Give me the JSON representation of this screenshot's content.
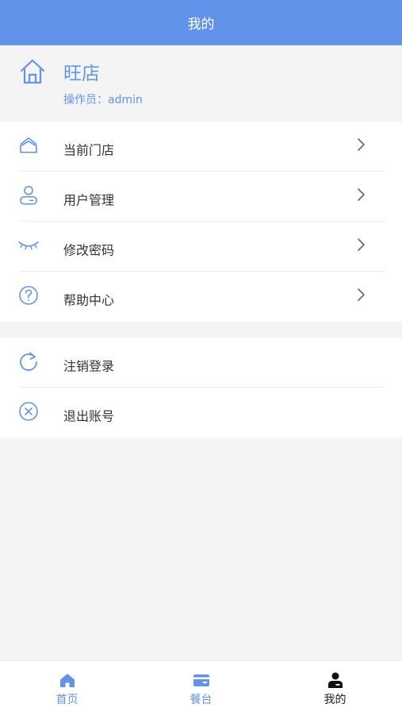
{
  "header": {
    "title": "我的"
  },
  "profile": {
    "store_name": "旺店",
    "operator": "操作员：admin",
    "icon": "home-outline-icon"
  },
  "menu_group_1": [
    {
      "label": "当前门店",
      "icon": "store-icon"
    },
    {
      "label": "用户管理",
      "icon": "user-icon"
    },
    {
      "label": "修改密码",
      "icon": "eye-closed-icon"
    },
    {
      "label": "帮助中心",
      "icon": "help-circle-icon"
    }
  ],
  "menu_group_2": [
    {
      "label": "注销登录",
      "icon": "refresh-icon"
    },
    {
      "label": "退出账号",
      "icon": "close-circle-icon"
    }
  ],
  "tab_bar": {
    "tabs": [
      {
        "label": "首页",
        "icon": "home-icon",
        "active": false
      },
      {
        "label": "餐台",
        "icon": "card-icon",
        "active": false
      },
      {
        "label": "我的",
        "icon": "person-icon",
        "active": true
      }
    ]
  },
  "colors": {
    "accent": "#6193ea",
    "background": "#f4f4f4",
    "text": "#333333"
  }
}
